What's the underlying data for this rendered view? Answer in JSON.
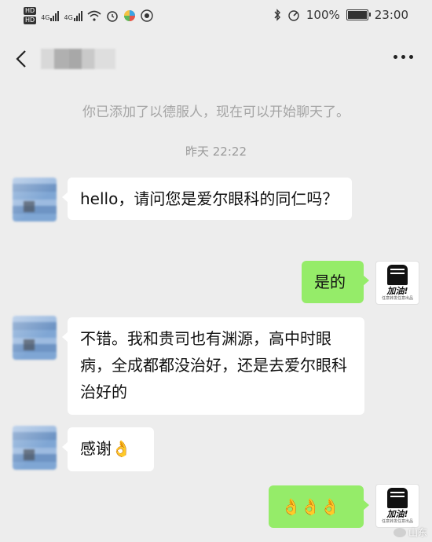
{
  "status_bar": {
    "hd1": "HD",
    "hd2": "HD",
    "net1": "4G",
    "net2": "4G",
    "battery_percent": "100%",
    "time": "23:00"
  },
  "header": {
    "contact_name": "█████",
    "back_icon": "chevron-left-icon",
    "more_icon": "more-dots-icon"
  },
  "chat": {
    "system_message": "你已添加了以德服人，现在可以开始聊天了。",
    "timestamp": "昨天 22:22",
    "messages": [
      {
        "side": "left",
        "text": "hello，请问您是爱尔眼科的同仁吗？"
      },
      {
        "side": "right",
        "text": "是的"
      },
      {
        "side": "left",
        "text": "不错。我和贵司也有渊源，高中时眼病，全成都都没治好，还是去爱尔眼科治好的"
      },
      {
        "side": "left",
        "text": "感谢👌"
      },
      {
        "side": "right",
        "text": "👌👌👌"
      }
    ]
  },
  "my_avatar": {
    "text": "加油!",
    "subtext": "任意转发任意出品"
  },
  "watermark": {
    "text": "山东"
  },
  "colors": {
    "background": "#ededed",
    "incoming_bubble": "#ffffff",
    "outgoing_bubble": "#95ec69"
  }
}
